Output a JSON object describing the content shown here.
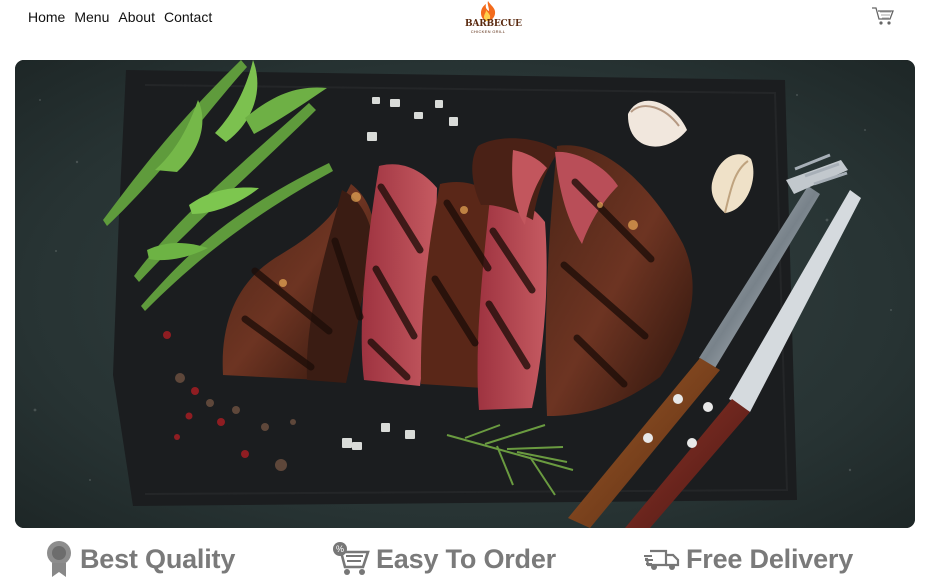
{
  "nav": {
    "items": [
      "Home",
      "Menu",
      "About",
      "Contact"
    ]
  },
  "brand": {
    "name": "BARBECUE",
    "subtitle": "CHICKEN GRILL",
    "flame_color": "#f36b1c"
  },
  "header": {
    "cart_icon": "cart-icon"
  },
  "hero": {
    "subject": "grilled steak on slate board",
    "board_color": "#1b1d1f",
    "background_color": "#27302f"
  },
  "features": [
    {
      "label": "Best Quality",
      "icon": "quality-badge-icon"
    },
    {
      "label": "Easy To Order",
      "icon": "shopping-cart-percent-icon"
    },
    {
      "label": "Free Delivery",
      "icon": "delivery-truck-icon"
    }
  ],
  "colors": {
    "feature_text": "#7a7a7a",
    "nav_text": "#111111"
  }
}
